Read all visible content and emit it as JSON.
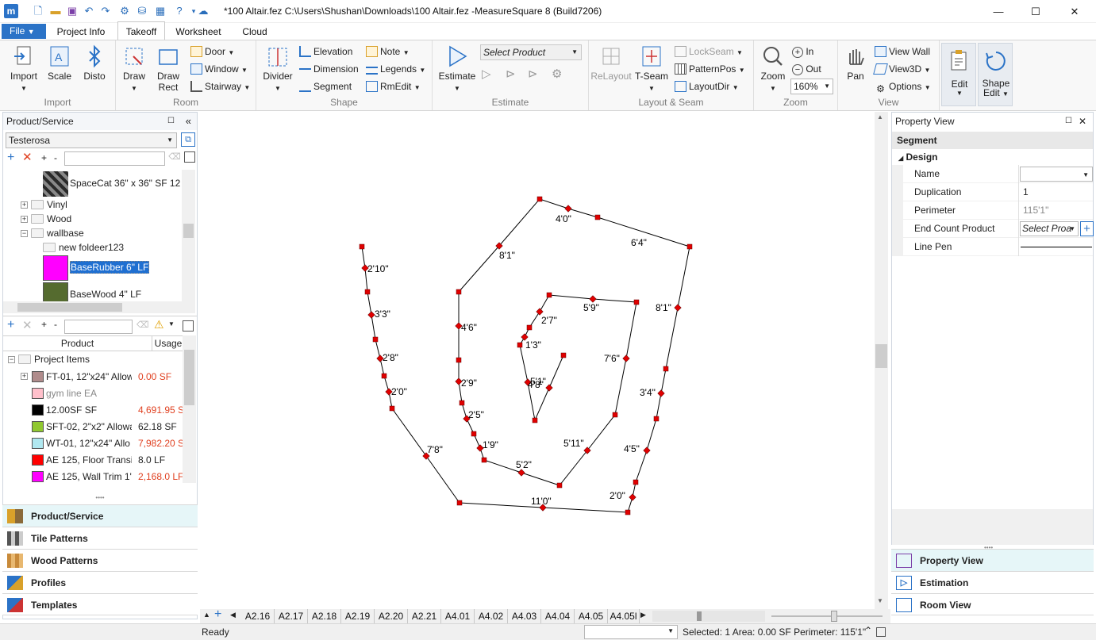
{
  "window": {
    "title": "*100 Altair.fez C:\\Users\\Shushan\\Downloads\\100 Altair.fez -MeasureSquare 8 (Build7206)",
    "logo": "m",
    "controls": {
      "minimize": "—",
      "maximize": "☐",
      "close": "✕"
    }
  },
  "tabs": [
    "File",
    "Project Info",
    "Takeoff",
    "Worksheet",
    "Cloud"
  ],
  "ribbon": {
    "import": {
      "label": "Import",
      "buttons": [
        "Import",
        "Scale",
        "Disto"
      ]
    },
    "room": {
      "label": "Room",
      "draw": "Draw",
      "draw_rect": "Draw Rect",
      "door": "Door",
      "window": "Window",
      "stairway": "Stairway"
    },
    "shape": {
      "label": "Shape",
      "divider": "Divider",
      "elevation": "Elevation",
      "dimension": "Dimension",
      "segment": "Segment",
      "note": "Note",
      "legends": "Legends",
      "rmedit": "RmEdit"
    },
    "estimate": {
      "label": "Estimate",
      "button": "Estimate",
      "select_product": "Select Product"
    },
    "layout": {
      "label": "Layout & Seam",
      "relayout": "ReLayout",
      "tseam": "T-Seam",
      "lockseam": "LockSeam",
      "patternpos": "PatternPos",
      "layoutdir": "LayoutDir"
    },
    "zoom": {
      "label": "Zoom",
      "button": "Zoom",
      "in": "In",
      "out": "Out",
      "level": "160%"
    },
    "view": {
      "label": "View",
      "pan": "Pan",
      "view_wall": "View Wall",
      "view3d": "View3D",
      "options": "Options"
    },
    "edit": {
      "edit": "Edit",
      "shape_edit": "Shape Edit"
    }
  },
  "product_panel": {
    "title": "Product/Service",
    "catalog": "Testerosa",
    "tree": [
      {
        "label": "SpaceCat 36\" x 36\" SF 12 S",
        "type": "image"
      },
      {
        "label": "Vinyl",
        "type": "folder",
        "expand": "+"
      },
      {
        "label": "Wood",
        "type": "folder",
        "expand": "+"
      },
      {
        "label": "wallbase",
        "type": "folder",
        "expand": "−"
      },
      {
        "label": "new foldeer123",
        "type": "folder"
      },
      {
        "label": "BaseRubber 6\" LF",
        "type": "swatch",
        "color": "#ff00ff",
        "selected": true
      },
      {
        "label": "BaseWood 4\" LF",
        "type": "swatch",
        "color": "#556b2f"
      }
    ]
  },
  "items_panel": {
    "headers": [
      "Product",
      "Usage"
    ],
    "root": "Project Items",
    "rows": [
      {
        "name": "FT-01, 12\"x24\" Allow",
        "usage": "0.00 SF",
        "color": "#b08c8c",
        "usage_red": true,
        "expand": "+"
      },
      {
        "name": "gym line  EA",
        "usage": "",
        "color": "#ffc0cb",
        "grey": true
      },
      {
        "name": "12.00SF  SF",
        "usage": "4,691.95 SF",
        "color": "#000000",
        "usage_red": true
      },
      {
        "name": "SFT-02, 2\"x2\" Allowa",
        "usage": "62.18 SF",
        "color": "#90c830",
        "usage_red": false
      },
      {
        "name": "WT-01, 12\"x24\" Allo",
        "usage": "7,982.20 SF",
        "color": "#b0e8f0",
        "usage_red": true
      },
      {
        "name": "AE 125, Floor Transit",
        "usage": "8.0 LF",
        "color": "#ff0000",
        "usage_red": false
      },
      {
        "name": "AE 125, Wall Trim 1\"",
        "usage": "2,168.0 LF",
        "color": "#ff00ff",
        "usage_red": true
      }
    ]
  },
  "left_nav": [
    "Product/Service",
    "Tile Patterns",
    "Wood Patterns",
    "Profiles",
    "Templates"
  ],
  "canvas": {
    "dims": [
      "4'0\"",
      "6'4\"",
      "8'1\"",
      "8'1\"",
      "2'10\"",
      "3'3\"",
      "2'8\"",
      "2'0\"",
      "7'8\"",
      "4'6\"",
      "2'9\"",
      "2'5\"",
      "1'9\"",
      "5'2\"",
      "11'0\"",
      "5'11\"",
      "4'5\"",
      "2'0\"",
      "3'4\"",
      "7'6\"",
      "5'9\"",
      "2'7\"",
      "1'3\"",
      "5'1\"",
      "4'8\""
    ]
  },
  "property_view": {
    "title": "Property View",
    "object": "Segment",
    "section": "Design",
    "rows": [
      {
        "name": "Name",
        "value": ""
      },
      {
        "name": "Duplication",
        "value": "1"
      },
      {
        "name": "Perimeter",
        "value": "115'1\""
      },
      {
        "name": "End Count Product",
        "value": "Select Proa"
      },
      {
        "name": "Line Pen",
        "value": ""
      }
    ]
  },
  "right_nav": [
    "Property View",
    "Estimation",
    "Room View"
  ],
  "sheets": [
    "A2.16",
    "A2.17",
    "A2.18",
    "A2.19",
    "A2.20",
    "A2.21",
    "A4.01",
    "A4.02",
    "A4.03",
    "A4.04",
    "A4.05",
    "A4.05l"
  ],
  "status": {
    "left": "Ready",
    "right": "Selected: 1 Area: 0.00 SF Perimeter: 115'1\""
  }
}
